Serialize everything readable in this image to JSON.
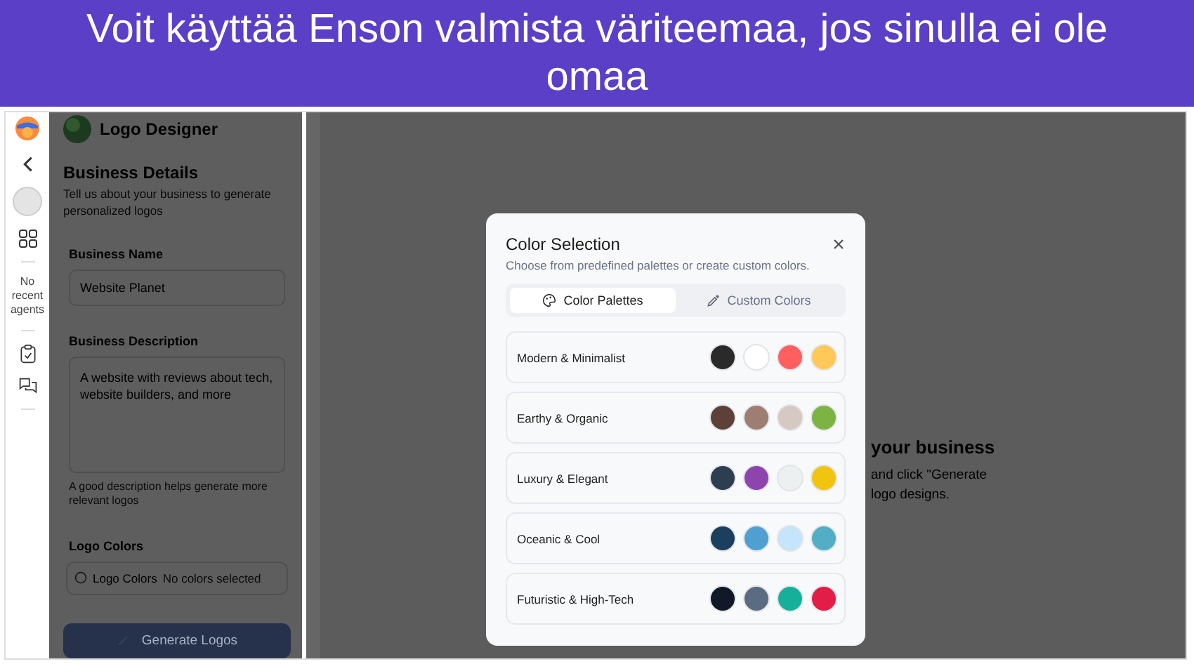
{
  "banner": {
    "text": "Voit käyttää Enson valmista väriteemaa, jos sinulla ei ole omaa"
  },
  "rail": {
    "recent_agents": "No recent agents"
  },
  "panel": {
    "app_title": "Logo Designer",
    "section_title": "Business Details",
    "section_subtitle": "Tell us about your business to generate personalized logos",
    "fields": [
      {
        "kind": "input",
        "label": "Business Name",
        "value": "Website Planet"
      },
      {
        "kind": "textarea",
        "label": "Business Description",
        "value": "A website with reviews about tech, website builders, and more",
        "hint": "A good description helps generate more relevant logos"
      }
    ],
    "colors": {
      "label": "Logo Colors",
      "button_label": "Logo Colors",
      "status": "No colors selected"
    },
    "generate_button": "Generate Logos"
  },
  "main": {
    "heading_fragment": "your business",
    "text_fragments": [
      "and click \"Generate",
      "logo designs."
    ]
  },
  "modal": {
    "title": "Color Selection",
    "subtitle": "Choose from predefined palettes or create custom colors.",
    "tabs": [
      {
        "kind": "palette",
        "label": "Color Palettes",
        "selected": true
      },
      {
        "kind": "picker",
        "label": "Custom Colors",
        "selected": false
      }
    ],
    "palettes": [
      {
        "name": "Modern & Minimalist",
        "swatches": [
          {
            "color": "#2a2a2a"
          },
          {
            "color": "#ffffff"
          },
          {
            "color": "#ff5f5f"
          },
          {
            "color": "#ffc857"
          }
        ]
      },
      {
        "name": "Earthy & Organic",
        "swatches": [
          {
            "color": "#5d4037"
          },
          {
            "color": "#9e7e72"
          },
          {
            "color": "#d6c8c2"
          },
          {
            "color": "#7cb342"
          }
        ]
      },
      {
        "name": "Luxury & Elegant",
        "swatches": [
          {
            "color": "#2c3e50"
          },
          {
            "color": "#8e44ad"
          },
          {
            "color": "#ecf0f1"
          },
          {
            "color": "#f1c40f"
          }
        ]
      },
      {
        "name": "Oceanic & Cool",
        "swatches": [
          {
            "color": "#1b3f5c"
          },
          {
            "color": "#4f9fd0"
          },
          {
            "color": "#c5e5fb"
          },
          {
            "color": "#52aec5"
          }
        ]
      },
      {
        "name": "Futuristic & High-Tech",
        "swatches": [
          {
            "color": "#111827"
          },
          {
            "color": "#5b6b82"
          },
          {
            "color": "#14b09a"
          },
          {
            "color": "#e11d48"
          }
        ]
      }
    ]
  }
}
